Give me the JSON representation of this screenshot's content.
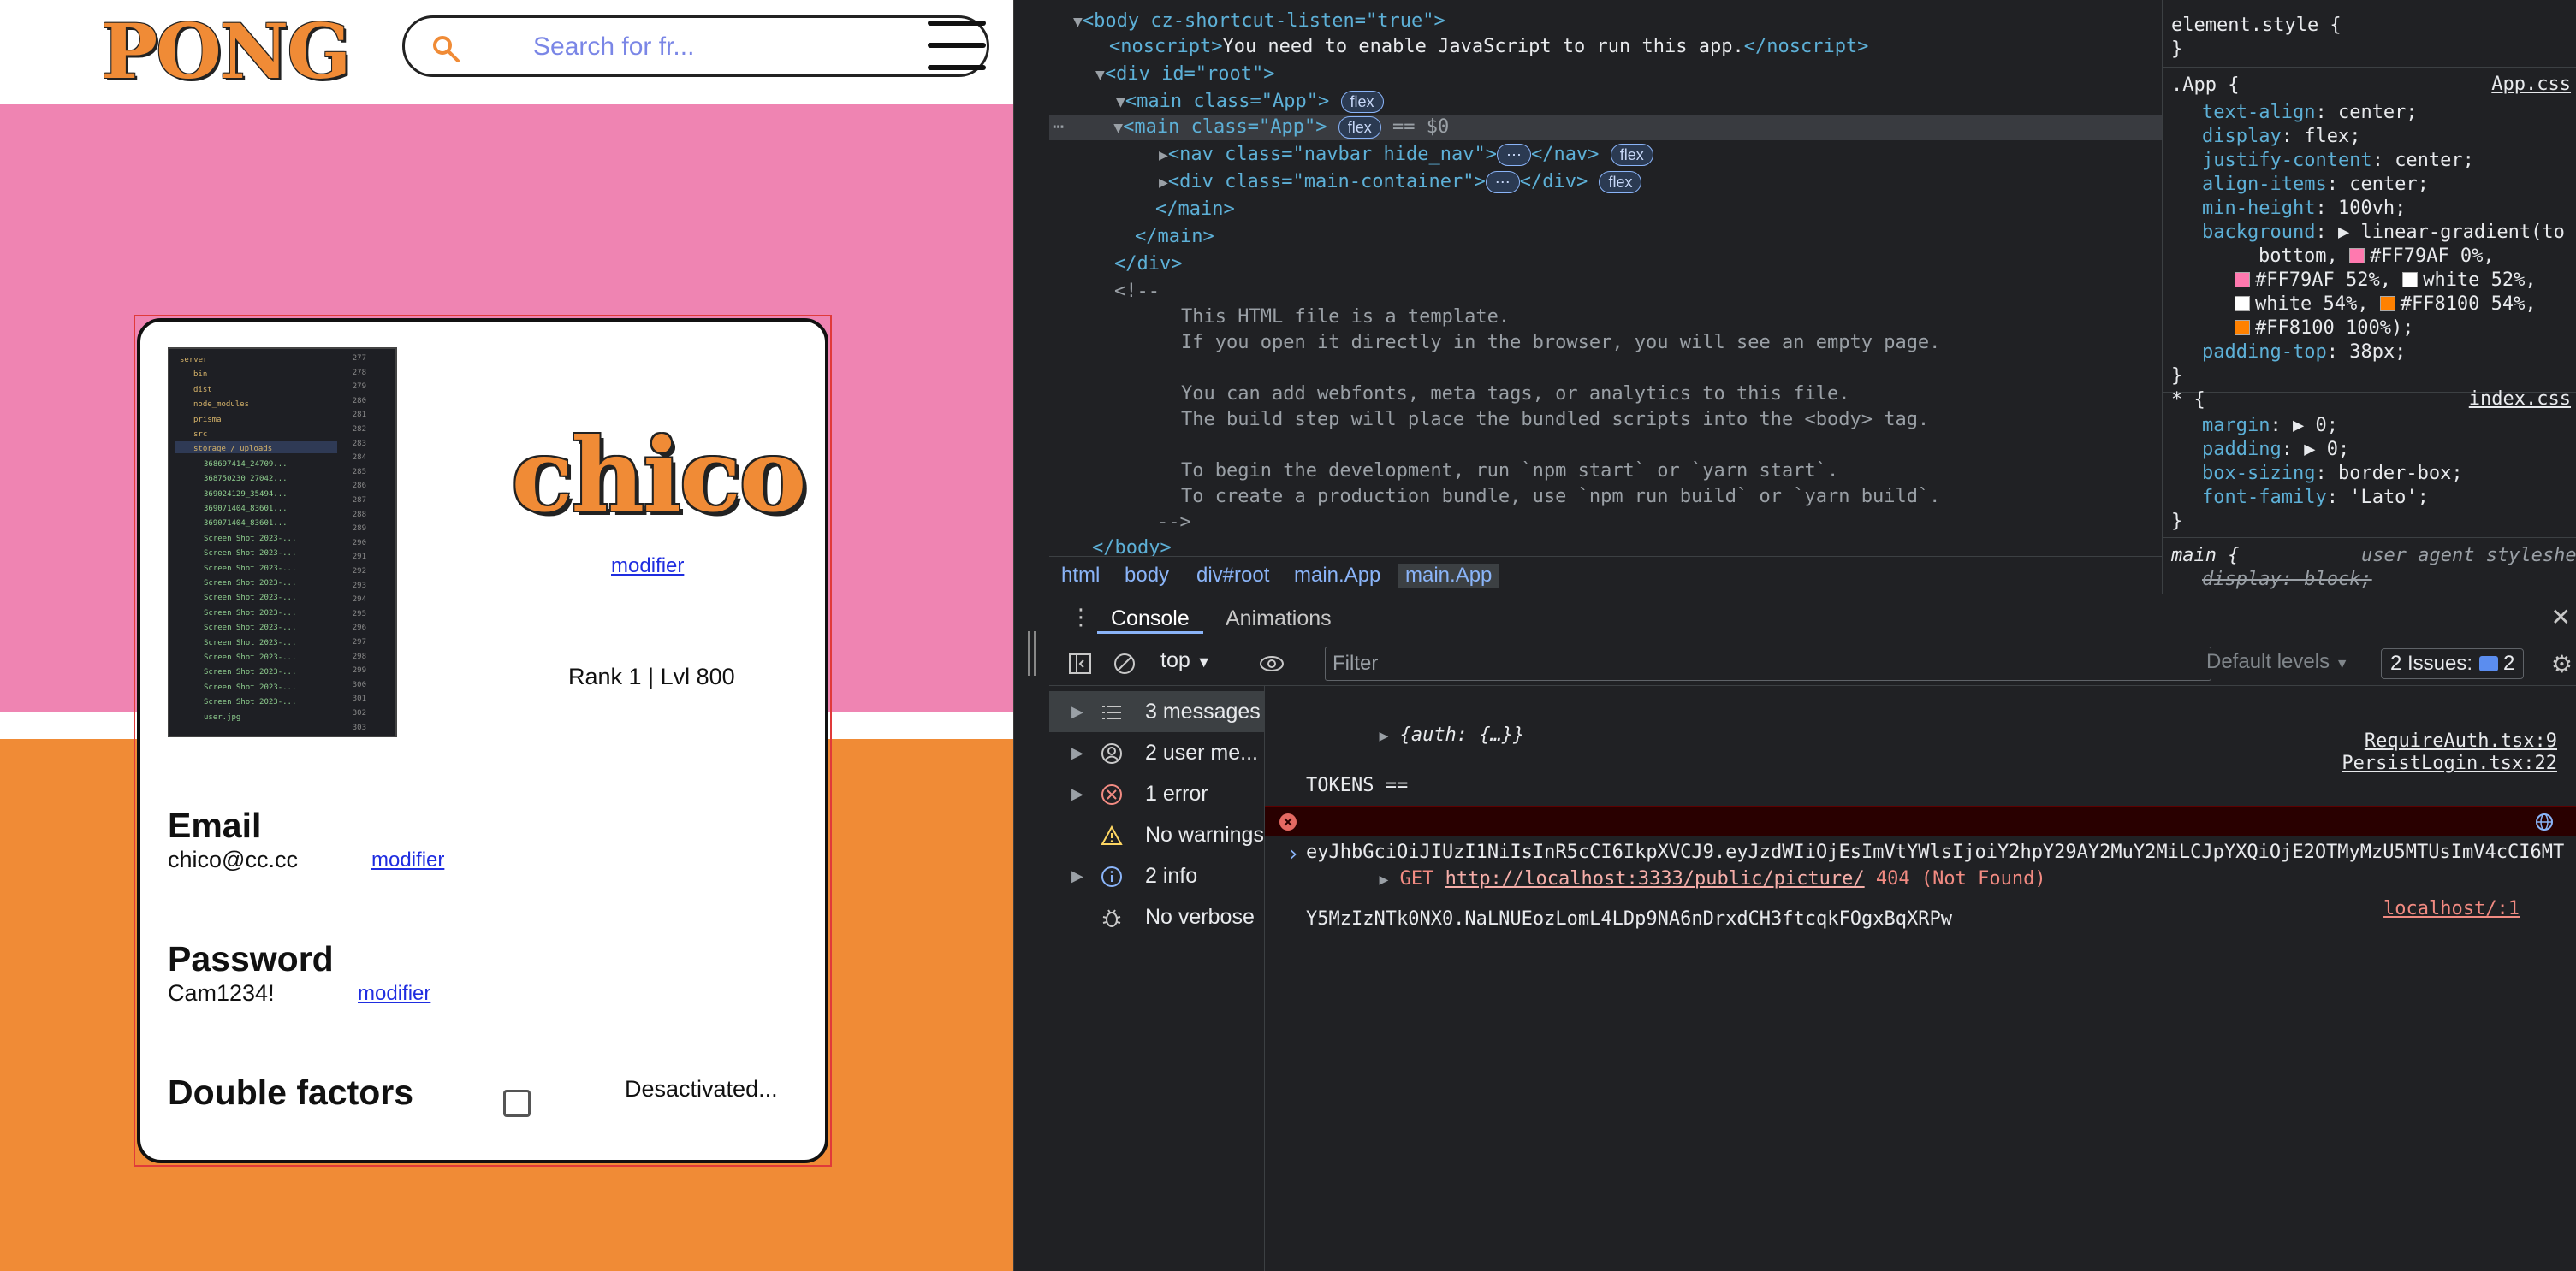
{
  "app": {
    "logo": "PONG",
    "search_placeholder": "Search for fr...",
    "profile": {
      "username": "chico",
      "username_modifier": "modifier",
      "rank_text": "Rank 1 | Lvl 800",
      "email_label": "Email",
      "email_value": "chico@cc.cc",
      "email_modifier": "modifier",
      "password_label": "Password",
      "password_value": "Cam1234!",
      "password_modifier": "modifier",
      "twofa_label": "Double factors",
      "twofa_status": "Desactivated...",
      "twofa_checked": false
    },
    "avatar_thumbnail": {
      "tree_rows": [
        "server",
        "bin",
        "dist",
        "node_modules",
        "prisma",
        "src",
        "storage / uploads",
        "368697414_24709...",
        "368750230_27042...",
        "369024129_35494...",
        "369071404_83601...",
        "369071404_83601...",
        "Screen Shot 2023-...",
        "Screen Shot 2023-...",
        "Screen Shot 2023-...",
        "Screen Shot 2023-...",
        "Screen Shot 2023-...",
        "Screen Shot 2023-...",
        "Screen Shot 2023-...",
        "Screen Shot 2023-...",
        "Screen Shot 2023-...",
        "Screen Shot 2023-...",
        "Screen Shot 2023-...",
        "Screen Shot 2023-...",
        "user.jpg"
      ],
      "line_numbers": [
        "277",
        "278",
        "279",
        "280",
        "281",
        "282",
        "283",
        "284",
        "285",
        "286",
        "287",
        "288",
        "289",
        "290",
        "291",
        "292",
        "293",
        "294",
        "295",
        "296",
        "297",
        "298",
        "299",
        "300",
        "301",
        "302",
        "303"
      ]
    }
  },
  "devtools": {
    "dom": {
      "line1": "<body cz-shortcut-listen=\"true\">",
      "line2_tag_open": "<noscript>",
      "line2_text": "You need to enable JavaScript to run this app.",
      "line2_tag_close": "</noscript>",
      "line3": "<div id=\"root\">",
      "line4": "<main class=\"App\">",
      "line5": "<main class=\"App\">",
      "line5_suffix": "== $0",
      "line6": "<nav class=\"navbar hide_nav\">",
      "line6_close": "</nav>",
      "line7": "<div class=\"main-container\">",
      "line7_close": "</div>",
      "line8": "</main>",
      "line9": "</main>",
      "line10": "</div>",
      "line11": "<!--",
      "comment1": "This HTML file is a template.",
      "comment2": "If you open it directly in the browser, you will see an empty page.",
      "comment3": "You can add webfonts, meta tags, or analytics to this file.",
      "comment4": "The build step will place the bundled scripts into the <body> tag.",
      "comment5": "To begin the development, run `npm start` or `yarn start`.",
      "comment6": "To create a production bundle, use `npm run build` or `yarn build`.",
      "comment_end": "-->",
      "body_close": "</body>",
      "badge_flex": "flex",
      "ellipsis": "⋯"
    },
    "breadcrumbs": [
      "html",
      "body",
      "div#root",
      "main.App",
      "main.App"
    ],
    "styles": {
      "element_style": "element.style {",
      "close_brace": "}",
      "app_selector": ".App {",
      "app_source": "App.css",
      "text_align_prop": "text-align",
      "text_align_val": "center;",
      "display_prop": "display",
      "display_val": "flex;",
      "justify_prop": "justify-content",
      "justify_val": "center;",
      "align_prop": "align-items",
      "align_val": "center;",
      "minh_prop": "min-height",
      "minh_val": "100vh;",
      "bg_prop": "background",
      "bg_val1": "linear-gradient(to",
      "bg_val2": "bottom,",
      "bg_stop1": "#FF79AF 0%,",
      "bg_stop2": "#FF79AF 52%,",
      "bg_stop3": "white 52%,",
      "bg_stop4": "white 54%,",
      "bg_stop5": "#FF8100 54%,",
      "bg_stop6": "#FF8100 100%);",
      "pt_prop": "padding-top",
      "pt_val": "38px;",
      "star_selector": "* {",
      "star_source": "index.css",
      "margin_prop": "margin",
      "margin_val": "0;",
      "padding_prop": "padding",
      "padding_val": "0;",
      "boxsizing_prop": "box-sizing",
      "boxsizing_val": "border-box;",
      "font_prop": "font-family",
      "font_val": "'Lato';",
      "main_selector": "main {",
      "main_source": "user agent styleshe",
      "main_display": "display: block;",
      "color_pink": "#FF79AF",
      "color_white": "#ffffff",
      "color_orange": "#FF8100"
    },
    "drawer": {
      "tab_console": "Console",
      "tab_animations": "Animations"
    },
    "console_toolbar": {
      "context": "top",
      "filter_placeholder": "Filter",
      "levels": "Default levels",
      "issues": "2 Issues:",
      "issues_count": "2"
    },
    "console_sidebar": [
      {
        "label": "3 messages",
        "icon": "list-icon"
      },
      {
        "label": "2 user me...",
        "icon": "user-icon"
      },
      {
        "label": "1 error",
        "icon": "error-icon"
      },
      {
        "label": "No warnings",
        "icon": "warning-icon"
      },
      {
        "label": "2 info",
        "icon": "info-icon"
      },
      {
        "label": "No verbose",
        "icon": "bug-icon"
      }
    ],
    "console_messages": {
      "msg1": "{auth: {…}}",
      "msg1_source": "PersistLogin.tsx:22",
      "msg2_line1": "TOKENS ==",
      "msg2_line2": "eyJhbGciOiJIUzI1NiIsInR5cCI6IkpXVCJ9.eyJzdWIiOjEsImVtYWlsIjoiY2hpY29AY2MuY2MiLCJpYXQiOjE2OTMyMzU5MTUsImV4cCI6MT",
      "msg2_line3": "Y5MzIzNTk0NX0.NaLNUEozLomL4LDp9NA6nDrxdCH3ftcqkFOgxBqXRPw",
      "msg2_source": "RequireAuth.tsx:9",
      "err_method": "GET",
      "err_url": "http://localhost:3333/public/picture/",
      "err_status": "404 (Not Found)",
      "err_source": "localhost/:1"
    }
  }
}
